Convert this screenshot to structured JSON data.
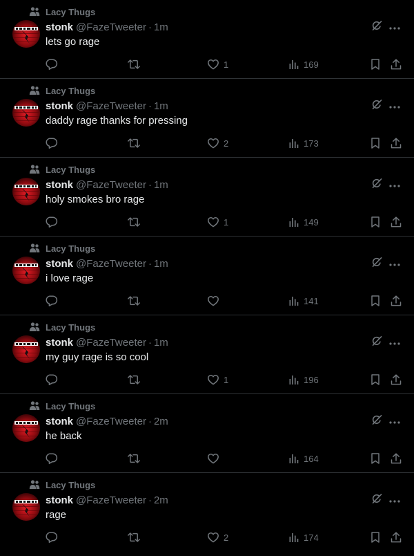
{
  "icons": {
    "social_context": "people-icon",
    "reply": "reply-icon",
    "repost": "repost-icon",
    "like": "heart-icon",
    "views": "views-chart-icon",
    "bookmark": "bookmark-icon",
    "share": "share-icon",
    "grok": "grok-icon",
    "more": "more-icon"
  },
  "colors": {
    "background": "#000000",
    "text_primary": "#e7e9ea",
    "text_secondary": "#71767b",
    "divider": "#2f3336",
    "avatar_red": "#c4121a"
  },
  "tweets": [
    {
      "context": "Lacy Thugs",
      "name": "stonk",
      "handle": "@FazeTweeter",
      "separator": "·",
      "time": "1m",
      "text": "lets go rage",
      "likes": "1",
      "views": "169"
    },
    {
      "context": "Lacy Thugs",
      "name": "stonk",
      "handle": "@FazeTweeter",
      "separator": "·",
      "time": "1m",
      "text": "daddy rage thanks for pressing",
      "likes": "2",
      "views": "173"
    },
    {
      "context": "Lacy Thugs",
      "name": "stonk",
      "handle": "@FazeTweeter",
      "separator": "·",
      "time": "1m",
      "text": "holy smokes bro rage",
      "likes": "1",
      "views": "149"
    },
    {
      "context": "Lacy Thugs",
      "name": "stonk",
      "handle": "@FazeTweeter",
      "separator": "·",
      "time": "1m",
      "text": "i love rage",
      "likes": "",
      "views": "141"
    },
    {
      "context": "Lacy Thugs",
      "name": "stonk",
      "handle": "@FazeTweeter",
      "separator": "·",
      "time": "1m",
      "text": "my guy rage is so cool",
      "likes": "1",
      "views": "196"
    },
    {
      "context": "Lacy Thugs",
      "name": "stonk",
      "handle": "@FazeTweeter",
      "separator": "·",
      "time": "2m",
      "text": "he back",
      "likes": "",
      "views": "164"
    },
    {
      "context": "Lacy Thugs",
      "name": "stonk",
      "handle": "@FazeTweeter",
      "separator": "·",
      "time": "2m",
      "text": "rage",
      "likes": "2",
      "views": "174"
    }
  ]
}
